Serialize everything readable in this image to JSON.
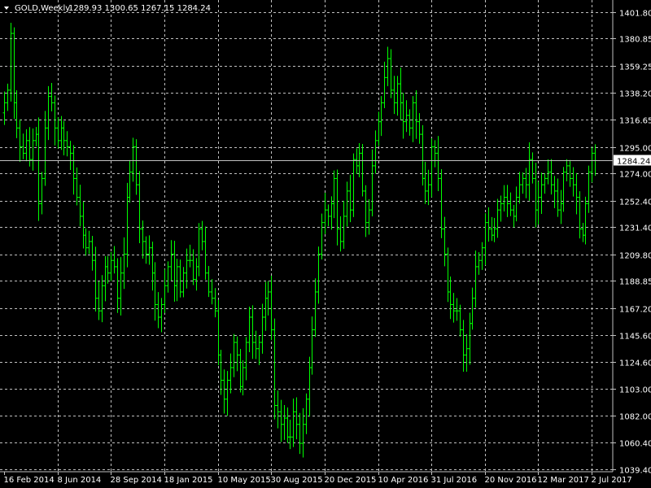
{
  "header": {
    "symbol": "GOLD,Weekly",
    "ohlc": "1289.93 1300.65 1267.15 1284.24",
    "dropdown_icon": "triangle-down-icon"
  },
  "colors": {
    "background": "#000000",
    "bars": "#00ff00",
    "grid": "#c0c0c0",
    "text": "#ffffff",
    "current_price_line": "#c0c0c0"
  },
  "chart_data": {
    "type": "ohlc",
    "title": "GOLD,Weekly",
    "xlabel": "",
    "ylabel": "",
    "grid": true,
    "current_price": 1284.24,
    "ylim": [
      1039.4,
      1401.8
    ],
    "y_tick_labels": [
      "1401.80",
      "1380.85",
      "1359.25",
      "1338.20",
      "1316.65",
      "1295.00",
      "1274.00",
      "1252.40",
      "1231.40",
      "1209.80",
      "1188.85",
      "1167.20",
      "1145.60",
      "1124.60",
      "1103.00",
      "1082.00",
      "1060.40",
      "1039.40"
    ],
    "x_tick_labels": [
      "16 Feb 2014",
      "8 Jun 2014",
      "28 Sep 2014",
      "18 Jan 2015",
      "10 May 2015",
      "30 Aug 2015",
      "20 Dec 2015",
      "10 Apr 2016",
      "31 Jul 2016",
      "20 Nov 2016",
      "12 Mar 2017",
      "2 Jul 2017"
    ],
    "series": [
      {
        "closes": [
          1330,
          1340,
          1385,
          1330,
          1310,
          1295,
          1290,
          1300,
          1285,
          1300,
          1305,
          1250,
          1270,
          1310,
          1335,
          1330,
          1310,
          1300,
          1310,
          1300,
          1295,
          1290,
          1270,
          1255,
          1240,
          1225,
          1215,
          1220,
          1205,
          1175,
          1165,
          1185,
          1200,
          1195,
          1205,
          1200,
          1175,
          1195,
          1210,
          1255,
          1275,
          1295,
          1265,
          1230,
          1220,
          1210,
          1215,
          1195,
          1170,
          1160,
          1170,
          1185,
          1200,
          1210,
          1185,
          1200,
          1180,
          1195,
          1205,
          1205,
          1190,
          1200,
          1230,
          1220,
          1195,
          1180,
          1175,
          1165,
          1130,
          1110,
          1095,
          1110,
          1120,
          1140,
          1130,
          1105,
          1120,
          1140,
          1160,
          1140,
          1135,
          1140,
          1160,
          1175,
          1180,
          1150,
          1090,
          1085,
          1075,
          1080,
          1065,
          1065,
          1085,
          1075,
          1060,
          1075,
          1095,
          1120,
          1150,
          1180,
          1210,
          1235,
          1245,
          1240,
          1250,
          1270,
          1230,
          1220,
          1240,
          1260,
          1245,
          1285,
          1280,
          1290,
          1260,
          1235,
          1245,
          1280,
          1300,
          1315,
          1330,
          1350,
          1365,
          1340,
          1330,
          1345,
          1330,
          1315,
          1320,
          1310,
          1330,
          1315,
          1305,
          1270,
          1260,
          1265,
          1295,
          1290,
          1270,
          1230,
          1210,
          1180,
          1170,
          1165,
          1165,
          1150,
          1130,
          1135,
          1155,
          1175,
          1200,
          1205,
          1215,
          1235,
          1230,
          1225,
          1230,
          1245,
          1250,
          1255,
          1250,
          1245,
          1240,
          1255,
          1265,
          1270,
          1265,
          1285,
          1270,
          1245,
          1255,
          1265,
          1270,
          1275,
          1265,
          1260,
          1245,
          1250,
          1275,
          1280,
          1270,
          1265,
          1255,
          1230,
          1225,
          1250,
          1275,
          1290,
          1284.24
        ]
      }
    ]
  }
}
